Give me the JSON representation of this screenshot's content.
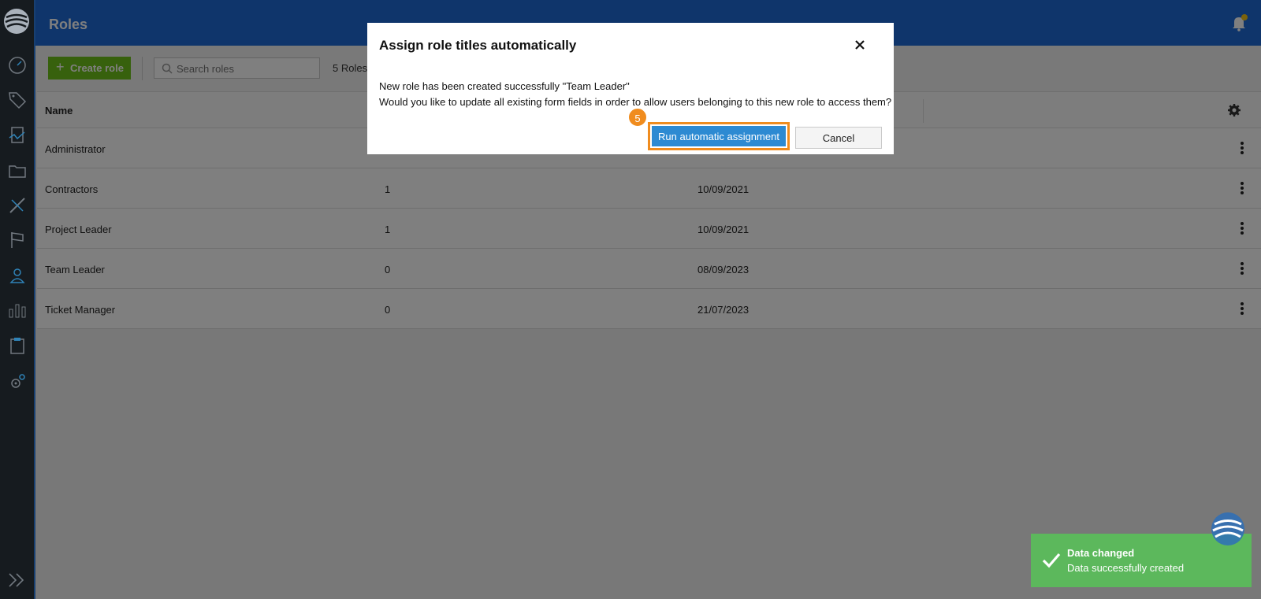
{
  "header": {
    "title": "Roles"
  },
  "toolbar": {
    "create_label": "Create role",
    "search_placeholder": "Search roles",
    "roles_count": "5 Roles"
  },
  "table": {
    "columns": [
      "Name"
    ],
    "rows": [
      {
        "name": "Administrator",
        "count": "",
        "date": ""
      },
      {
        "name": "Contractors",
        "count": "1",
        "date": "10/09/2021"
      },
      {
        "name": "Project Leader",
        "count": "1",
        "date": "10/09/2021"
      },
      {
        "name": "Team Leader",
        "count": "0",
        "date": "08/09/2023"
      },
      {
        "name": "Ticket Manager",
        "count": "0",
        "date": "21/07/2023"
      }
    ]
  },
  "modal": {
    "title": "Assign role titles automatically",
    "line1": "New role has been created successfully \"Team Leader\"",
    "line2": "Would you like to update all existing form fields in order to allow users belonging to this new role to access them?",
    "run_label": "Run automatic assignment",
    "cancel_label": "Cancel",
    "step_number": "5"
  },
  "toast": {
    "title": "Data changed",
    "message": "Data successfully created"
  },
  "icons": {
    "sidebar": [
      "dashboard-icon",
      "tag-icon",
      "forms-icon",
      "folder-icon",
      "tools-icon",
      "flag-icon",
      "user-icon",
      "chart-icon",
      "clipboard-icon",
      "settings-icon"
    ]
  },
  "colors": {
    "header": "#1e6bd6",
    "sidebar": "#1b2127",
    "create_button": "#6fc21b",
    "run_button": "#2d8ad2",
    "highlight": "#f08c1e",
    "toast": "#5cb85c"
  }
}
